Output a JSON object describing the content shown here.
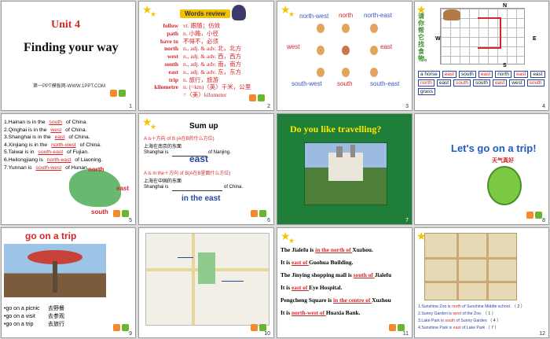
{
  "slides": [
    {
      "n": "1",
      "unit": "Unit 4",
      "title": "Finding your way",
      "foot": "第一PPT模板网-WWW.1PPT.COM"
    },
    {
      "n": "2",
      "header": "Words review",
      "rows": [
        [
          "follow",
          "vt. 跟随；仿效"
        ],
        [
          "path",
          "n. 小路，小径"
        ],
        [
          "have to",
          "不得不，必须"
        ],
        [
          "north",
          "n., adj. & adv. 北，北方"
        ],
        [
          "west",
          "n., adj. & adv. 西，西方"
        ],
        [
          "south",
          "n., adj. & adv. 南，南方"
        ],
        [
          "east",
          "n., adj. & adv. 东，东方"
        ],
        [
          "trip",
          "n. 旅行，旅游"
        ],
        [
          "kilometre",
          "n. (=km)〈英〉千米，公里"
        ],
        [
          "",
          "=〈美〉kilometer"
        ]
      ]
    },
    {
      "n": "3",
      "labels": [
        "north-west",
        "north",
        "north-east",
        "west",
        "east",
        "south-west",
        "south",
        "south-east"
      ]
    },
    {
      "n": "4",
      "side": "请你帮它找食物。",
      "dirs": [
        "N",
        "W",
        "E",
        "S"
      ],
      "words": [
        "a horse",
        "east",
        "south",
        "east",
        "north",
        "east",
        "east",
        "north",
        "east",
        "south",
        "south",
        "east",
        "west",
        "south",
        "grass"
      ]
    },
    {
      "n": "5",
      "lines": [
        [
          "1.Hainan is in the",
          "south",
          "of China."
        ],
        [
          "2.Qinghai is in the",
          "west",
          "of China."
        ],
        [
          "3.Shanghai is in the",
          "east",
          "of China."
        ],
        [
          "4.Xinjiang is in the",
          "north-west",
          "of China."
        ],
        [
          "5.Taiwai is in",
          "south-east",
          "of Fujian."
        ],
        [
          "6.Heilongjiang is",
          "north-east",
          "of Liaoning."
        ],
        [
          "7.Yunnan is",
          "south-west",
          "of Hunan."
        ]
      ],
      "map": [
        "north",
        "east",
        "south"
      ]
    },
    {
      "n": "6",
      "title": "Sum up",
      "a1": "A is＋方向 of B (A在B的什么方位)",
      "b1": "上海在南京的东面",
      "s1a": "Shanghai is",
      "s1b": "of Nanjing.",
      "big1": "east",
      "a2": "A is in the＋方向 of B(A在B里面什么方位)",
      "b2": "上海在中国的东面",
      "s2a": "Shanghai is",
      "s2b": "of China.",
      "big2": "in the east"
    },
    {
      "n": "7",
      "title": "Do you like travelling?"
    },
    {
      "n": "8",
      "title": "Let's go on a trip!",
      "badge": "天气真好"
    },
    {
      "n": "9",
      "title": "go on a trip",
      "items": [
        [
          "•go on a picnic",
          "去野餐"
        ],
        [
          "•go on a visit",
          "去参观"
        ],
        [
          "•go on a trip",
          "去旅行"
        ]
      ]
    },
    {
      "n": "10"
    },
    {
      "n": "11",
      "lines": [
        [
          "The Jialefu is ",
          "in the north of ",
          "Xuzhou."
        ],
        [
          "It is ",
          "east of ",
          "Guohua Building."
        ],
        [
          "The Jinying shopping mall is ",
          "south of ",
          "Jialefu"
        ],
        [
          "It is ",
          "east of ",
          "Eye Hospital."
        ],
        [
          "Pengcheng Square is ",
          "in the centre of ",
          "Xuzhou"
        ],
        [
          "It is ",
          "north-west of ",
          "Huaxia Bank."
        ]
      ]
    },
    {
      "n": "12",
      "lines": [
        [
          "1.",
          "Sunshine Zoo is ",
          "north",
          "of",
          "Sunshine Middle school.",
          "（ 2 ）"
        ],
        [
          "2.",
          "Sunny Garden is ",
          "west",
          "of the Zoo.",
          "",
          "（ 1 ）"
        ],
        [
          "3.",
          "Lake Park is ",
          "south",
          "of Sunny Garden",
          "",
          "（ 4 ）"
        ],
        [
          "4.",
          "Sunshine Park is ",
          "east",
          "of Lake Park",
          "",
          "（ 7 ）"
        ]
      ]
    }
  ]
}
